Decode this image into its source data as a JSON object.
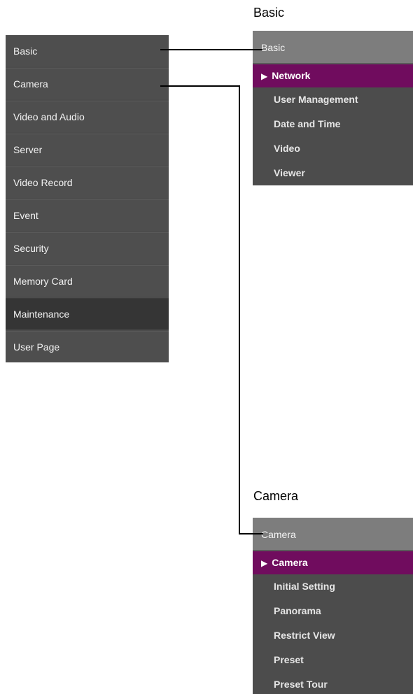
{
  "main_menu": {
    "items": [
      {
        "label": "Basic"
      },
      {
        "label": "Camera"
      },
      {
        "label": "Video and Audio"
      },
      {
        "label": "Server"
      },
      {
        "label": "Video Record"
      },
      {
        "label": "Event"
      },
      {
        "label": "Security"
      },
      {
        "label": "Memory Card"
      },
      {
        "label": "Maintenance"
      },
      {
        "label": "User Page"
      }
    ]
  },
  "basic_panel": {
    "caption": "Basic",
    "header": "Basic",
    "active_arrow": "▶",
    "items": [
      {
        "label": "Network"
      },
      {
        "label": "User Management"
      },
      {
        "label": "Date and Time"
      },
      {
        "label": "Video"
      },
      {
        "label": "Viewer"
      }
    ]
  },
  "camera_panel": {
    "caption": "Camera",
    "header": "Camera",
    "active_arrow": "▶",
    "items": [
      {
        "label": "Camera"
      },
      {
        "label": "Initial Setting"
      },
      {
        "label": "Panorama"
      },
      {
        "label": "Restrict View"
      },
      {
        "label": "Preset"
      },
      {
        "label": "Preset Tour"
      }
    ]
  },
  "colors": {
    "menu_bg": "#4e4e4e",
    "menu_dark": "#353535",
    "header_bg": "#7d7d7d",
    "active_bg": "#700c5e"
  }
}
